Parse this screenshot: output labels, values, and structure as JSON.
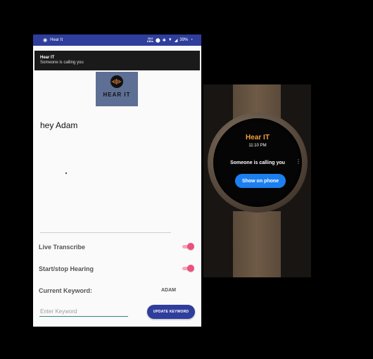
{
  "phone": {
    "status_bar": {
      "eye_icon": "eye-icon",
      "app_name": "Hear It",
      "net_speed_value": "15.0",
      "net_speed_unit": "KB/s",
      "battery": "39%",
      "icons": [
        "location-icon",
        "bluetooth-icon",
        "wifi-icon",
        "signal-icon",
        "battery-icon"
      ]
    },
    "notification": {
      "title": "Hear IT",
      "body": "Someone is calling you"
    },
    "logo": {
      "text": "HEAR IT",
      "icon": "sound-wave-icon"
    },
    "greeting": "hey Adam",
    "settings": {
      "live_transcribe_label": "Live Transcribe",
      "live_transcribe_on": true,
      "start_stop_label": "Start/stop Hearing",
      "start_stop_on": true,
      "current_keyword_label": "Current Keyword:",
      "current_keyword_value": "ADAM"
    },
    "keyword_input": {
      "placeholder": "Enter Keyword",
      "value": ""
    },
    "update_button_label": "UPDATE KEYWORD",
    "colors": {
      "primary": "#2f3d9c",
      "accent": "#ee4f7c",
      "input_underline": "#2d8c7d"
    }
  },
  "watch": {
    "title": "Hear IT",
    "time": "11:10 PM",
    "message": "Someone is calling you",
    "button_label": "Show on phone",
    "more_icon": "more-vert-icon",
    "colors": {
      "title": "#f2a03d",
      "button": "#1c7ff0"
    }
  }
}
